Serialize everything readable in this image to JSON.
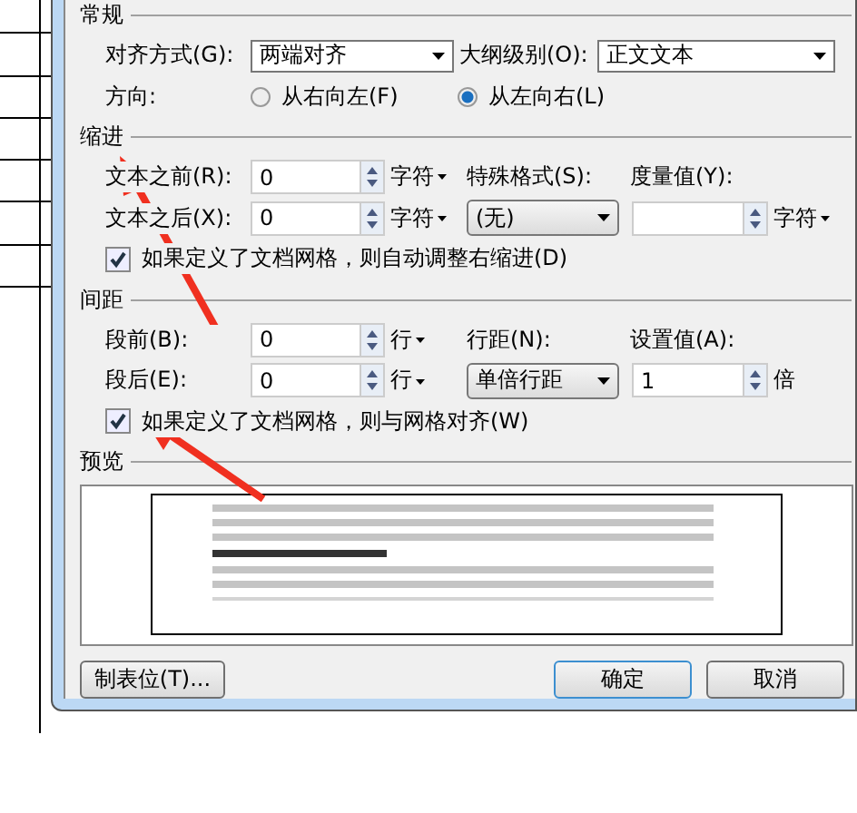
{
  "general": {
    "heading": "常规",
    "alignment": {
      "label": "对齐方式(G):",
      "value": "两端对齐"
    },
    "outline": {
      "label": "大纲级别(O):",
      "value": "正文文本"
    },
    "direction": {
      "label": "方向:",
      "options": [
        {
          "label": "从右向左(F)",
          "selected": false
        },
        {
          "label": "从左向右(L)",
          "selected": true
        }
      ]
    }
  },
  "indent": {
    "heading": "缩进",
    "before": {
      "label": "文本之前(R):",
      "value": "0",
      "unit": "字符"
    },
    "after": {
      "label": "文本之后(X):",
      "value": "0",
      "unit": "字符"
    },
    "special": {
      "label": "特殊格式(S):",
      "value": "(无)"
    },
    "measure": {
      "label": "度量值(Y):",
      "unit": "字符"
    },
    "auto_adjust": {
      "label": "如果定义了文档网格，则自动调整右缩进(D)",
      "checked": true
    }
  },
  "spacing": {
    "heading": "间距",
    "before": {
      "label": "段前(B):",
      "value": "0",
      "unit": "行"
    },
    "after": {
      "label": "段后(E):",
      "value": "0",
      "unit": "行"
    },
    "line": {
      "label": "行距(N):",
      "value": "单倍行距"
    },
    "setting": {
      "label": "设置值(A):",
      "value": "1",
      "unit": "倍"
    },
    "snap": {
      "label": "如果定义了文档网格，则与网格对齐(W)",
      "checked": true
    }
  },
  "preview": {
    "heading": "预览"
  },
  "buttons": [
    {
      "label": "制表位(T)...",
      "default": false
    },
    {
      "label": "确定",
      "default": true
    },
    {
      "label": "取消",
      "default": false
    }
  ]
}
